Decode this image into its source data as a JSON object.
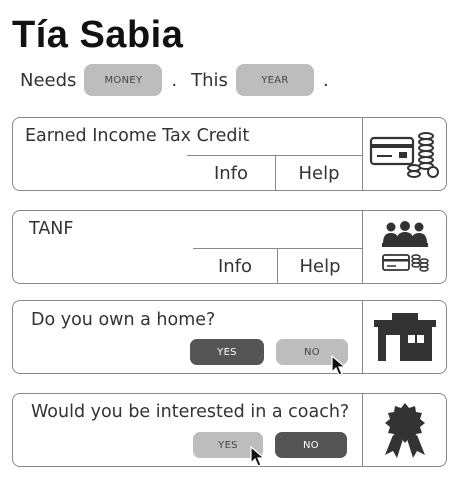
{
  "app": {
    "title": "Tía Sabia"
  },
  "filters": {
    "prefix": "Needs",
    "needs_value": "MONEY",
    "separator1": ".",
    "middle": "This",
    "time_value": "YEAR",
    "separator2": "."
  },
  "cards": [
    {
      "title": "Earned Income Tax Credit",
      "info_label": "Info",
      "help_label": "Help",
      "icon": "credit-card-coins-icon"
    },
    {
      "title": "TANF",
      "info_label": "Info",
      "help_label": "Help",
      "icon": "family-money-icon"
    },
    {
      "title": "Do you own a home?",
      "yes_label": "YES",
      "no_label": "NO",
      "selected": "NO",
      "icon": "house-icon"
    },
    {
      "title": "Would you be interested in a coach?",
      "yes_label": "YES",
      "no_label": "NO",
      "selected": "YES",
      "icon": "award-ribbon-icon"
    }
  ]
}
